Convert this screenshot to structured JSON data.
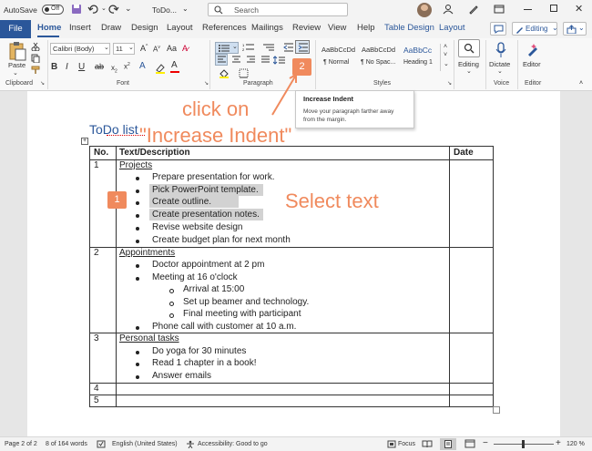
{
  "titlebar": {
    "autosave_label": "AutoSave",
    "autosave_state": "Off",
    "doc_name": "ToDo...",
    "search_placeholder": "Search"
  },
  "tabs": [
    "File",
    "Home",
    "Insert",
    "Draw",
    "Design",
    "Layout",
    "References",
    "Mailings",
    "Review",
    "View",
    "Help",
    "Table Design",
    "Layout"
  ],
  "ribbon": {
    "paste": "Paste",
    "font_name": "Calibri (Body)",
    "font_size": "11",
    "styles": [
      {
        "preview": "AaBbCcDd",
        "name": "¶ Normal"
      },
      {
        "preview": "AaBbCcDd",
        "name": "¶ No Spac..."
      },
      {
        "preview": "AaBbCc",
        "name": "Heading 1"
      }
    ],
    "editing_btn": "Editing",
    "dictate": "Dictate",
    "editor": "Editor",
    "editing_mode": "Editing",
    "groups": [
      "Clipboard",
      "Font",
      "Paragraph",
      "Styles",
      "Voice",
      "Editor"
    ]
  },
  "tooltip": {
    "title": "Increase Indent",
    "body_line1": "Move your paragraph farther away",
    "body_line2": "from the margin."
  },
  "annotations": {
    "badge1": "1",
    "badge2": "2",
    "click_on": "click on",
    "increase_indent": "\"Increase Indent\"",
    "select_text": "Select text"
  },
  "document": {
    "title": "ToDo list",
    "headers": [
      "No.",
      "Text/Description",
      "Date"
    ],
    "rows": [
      {
        "no": "1",
        "heading": "Projects",
        "items": [
          "Prepare presentation for work.",
          "Pick PowerPoint template.",
          "Create outline.",
          "Create presentation notes.",
          "Revise website design",
          "Create budget plan for next month"
        ]
      },
      {
        "no": "2",
        "heading": "Appointments",
        "items": [
          "Doctor appointment at 2 pm",
          "Meeting at 16 o'clock",
          "Arrival at 15:00",
          "Set up beamer and technology.",
          "Final meeting with participant",
          "Phone call with customer at 10 a.m."
        ]
      },
      {
        "no": "3",
        "heading": "Personal tasks",
        "items": [
          "Do yoga for 30 minutes",
          "Read 1 chapter in a book!",
          "Answer emails"
        ]
      },
      {
        "no": "4"
      },
      {
        "no": "5"
      }
    ]
  },
  "status": {
    "page": "Page 2 of 2",
    "words": "8 of 164 words",
    "language": "English (United States)",
    "accessibility": "Accessibility: Good to go",
    "focus": "Focus",
    "zoom": "120 %"
  },
  "colors": {
    "accent": "#2b579a",
    "annotation": "#f08a5d",
    "selection": "#d2d2d2"
  }
}
